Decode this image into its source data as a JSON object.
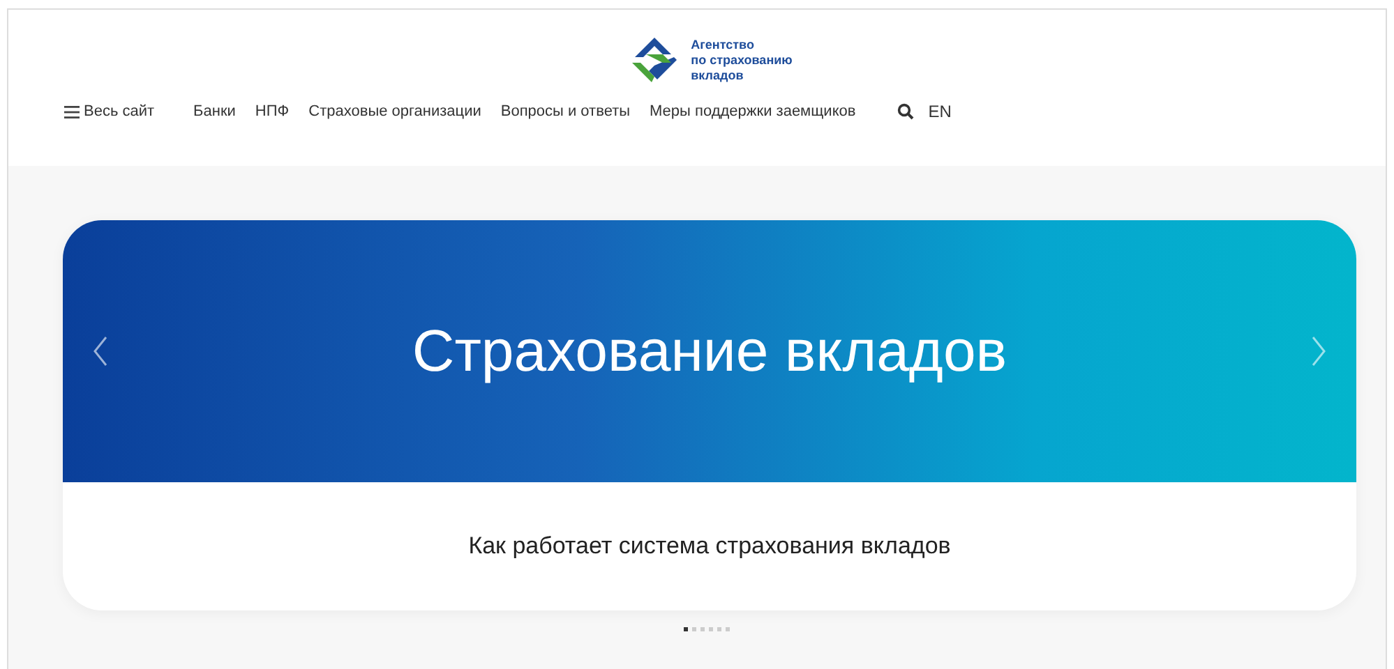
{
  "logo": {
    "lines": [
      "Агентство",
      "по страхованию",
      "вкладов"
    ]
  },
  "nav": {
    "menu": "Весь сайт",
    "items": [
      "Банки",
      "НПФ",
      "Страховые организации",
      "Вопросы и ответы",
      "Меры поддержки заемщиков"
    ],
    "language": "EN"
  },
  "slider": {
    "title": "Страхование вкладов",
    "caption": "Как работает система страхования вкладов",
    "dots": [
      {
        "selected": true
      },
      {
        "selected": false
      },
      {
        "selected": false
      },
      {
        "selected": false
      },
      {
        "selected": false
      },
      {
        "selected": false
      }
    ]
  }
}
